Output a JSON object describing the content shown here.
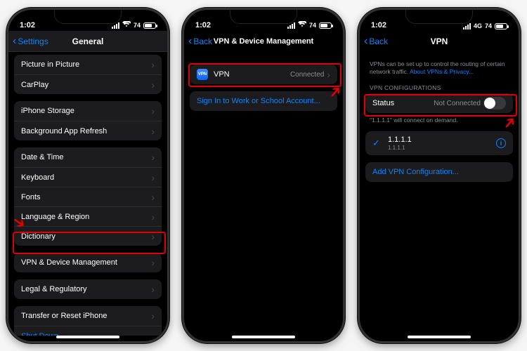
{
  "status": {
    "time": "1:02",
    "battery_pct": "74",
    "cell_label": "4G"
  },
  "screen1": {
    "back_label": "Settings",
    "title": "General",
    "rows": {
      "pip": "Picture in Picture",
      "carplay": "CarPlay",
      "storage": "iPhone Storage",
      "bg_refresh": "Background App Refresh",
      "date_time": "Date & Time",
      "keyboard": "Keyboard",
      "fonts": "Fonts",
      "lang_region": "Language & Region",
      "dictionary": "Dictionary",
      "vpn_dm": "VPN & Device Management",
      "legal": "Legal & Regulatory",
      "transfer": "Transfer or Reset iPhone",
      "shutdown": "Shut Down"
    }
  },
  "screen2": {
    "back_label": "Back",
    "title": "VPN & Device Management",
    "vpn_label": "VPN",
    "vpn_status": "Connected",
    "signin": "Sign In to Work or School Account..."
  },
  "screen3": {
    "back_label": "Back",
    "title": "VPN",
    "desc_text": "VPNs can be set up to control the routing of certain network traffic. ",
    "desc_link": "About VPNs & Privacy...",
    "header_configs": "VPN CONFIGURATIONS",
    "status_label": "Status",
    "status_value": "Not Connected",
    "ondemand_note": "\"1.1.1.1\" will connect on demand.",
    "config_name": "1.1.1.1",
    "config_sub": "1.1.1.1",
    "add_config": "Add VPN Configuration..."
  },
  "annotations": {
    "highlight_color": "#e00000"
  }
}
